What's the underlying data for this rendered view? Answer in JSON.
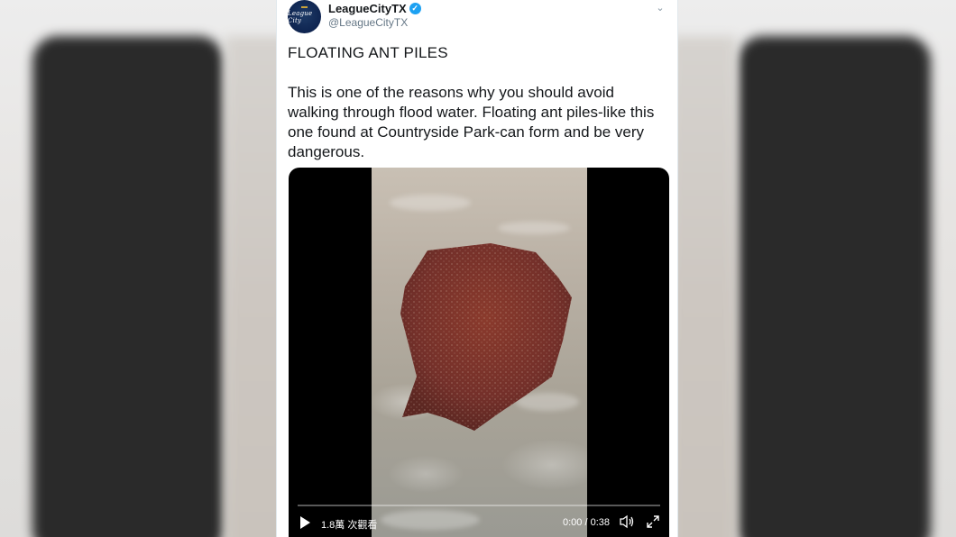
{
  "tweet": {
    "display_name": "LeagueCityTX",
    "handle": "@LeagueCityTX",
    "verified": true,
    "avatar_text": "League City",
    "title": "FLOATING ANT PILES",
    "text": "This is one of the reasons why you should avoid walking through flood water. Floating ant piles-like this one found at Countryside Park-can form and be very dangerous."
  },
  "video": {
    "views_label": "1.8萬 次觀看",
    "time_label": "0:00 / 0:38",
    "progress": 0,
    "icons": {
      "play": "play-icon",
      "volume": "volume-icon",
      "fullscreen": "fullscreen-icon"
    }
  },
  "colors": {
    "verified": "#1da1f2",
    "avatar_bg": "#0e2450",
    "text": "#14171a",
    "secondary_text": "#657786"
  }
}
